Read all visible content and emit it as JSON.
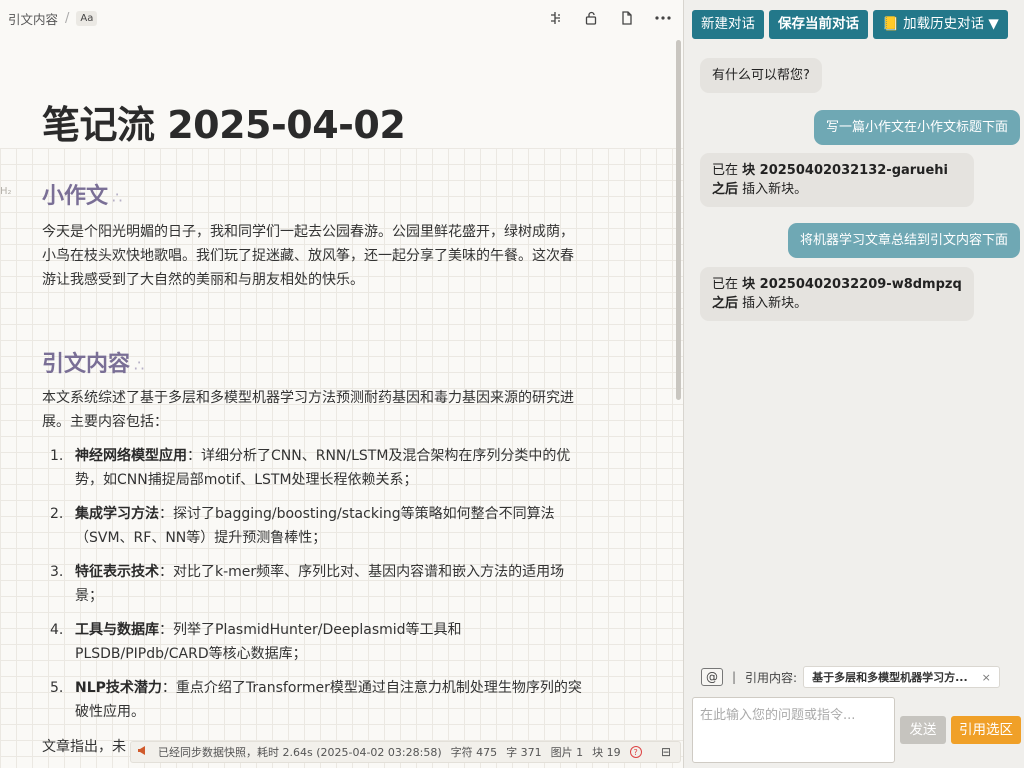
{
  "breadcrumb": {
    "path": "引文内容",
    "separator": "/",
    "aa_label": "Aa"
  },
  "toolbar_icons": [
    "outline-icon",
    "lock-icon",
    "document-icon",
    "more-icon"
  ],
  "document": {
    "title": "笔记流 2025-04-02",
    "heading_marker": "H₂",
    "dots": "∴",
    "section1": {
      "heading": "小作文",
      "body": "今天是个阳光明媚的日子，我和同学们一起去公园春游。公园里鲜花盛开，绿树成荫，小鸟在枝头欢快地歌唱。我们玩了捉迷藏、放风筝，还一起分享了美味的午餐。这次春游让我感受到了大自然的美丽和与朋友相处的快乐。"
    },
    "section2": {
      "heading": "引文内容",
      "intro": "本文系统综述了基于多层和多模型机器学习方法预测耐药基因和毒力基因来源的研究进展。主要内容包括：",
      "items": [
        {
          "num": "1.",
          "term": "神经网络模型应用",
          "text": "：详细分析了CNN、RNN/LSTM及混合架构在序列分类中的优势，如CNN捕捉局部motif、LSTM处理长程依赖关系；"
        },
        {
          "num": "2.",
          "term": "集成学习方法",
          "text": "：探讨了bagging/boosting/stacking等策略如何整合不同算法（SVM、RF、NN等）提升预测鲁棒性；"
        },
        {
          "num": "3.",
          "term": "特征表示技术",
          "text": "：对比了k-mer频率、序列比对、基因内容谱和嵌入方法的适用场景；"
        },
        {
          "num": "4.",
          "term": "工具与数据库",
          "text": "：列举了PlasmidHunter/Deeplasmid等工具和PLSDB/PIPdb/CARD等核心数据库；"
        },
        {
          "num": "5.",
          "term": "NLP技术潜力",
          "text": "：重点介绍了Transformer模型通过自注意力机制处理生物序列的突破性应用。"
        }
      ],
      "trailing_text": "文章指出，未"
    }
  },
  "status_bar": {
    "message": "已经同步数据快照，耗时 2.64s (2025-04-02 03:28:58)",
    "chars": "字符 475",
    "words": "字 371",
    "images": "图片 1",
    "blocks": "块 19",
    "help": "?"
  },
  "chat": {
    "buttons": {
      "new": "新建对话",
      "save": "保存当前对话",
      "load": "📒 加载历史对话 ▼"
    },
    "messages": [
      {
        "role": "ai",
        "text": "有什么可以帮您?"
      },
      {
        "role": "user",
        "text": "写一篇小作文在小作文标题下面"
      },
      {
        "role": "ai",
        "prefix": "已在 ",
        "bold": "块 20250402032132-garuehi 之后",
        "suffix": " 插入新块。"
      },
      {
        "role": "user",
        "text": "将机器学习文章总结到引文内容下面"
      },
      {
        "role": "ai",
        "prefix": "已在 ",
        "bold": "块 20250402032209-w8dmpzq 之后",
        "suffix": " 插入新块。"
      }
    ],
    "at_label": "@",
    "ref_label": "引用内容:",
    "ref_chip": "基于多层和多模型机器学习方...",
    "ref_chip_close": "×",
    "input_placeholder": "在此输入您的问题或指令...",
    "send_label": "发送",
    "cite_label": "引用选区"
  }
}
